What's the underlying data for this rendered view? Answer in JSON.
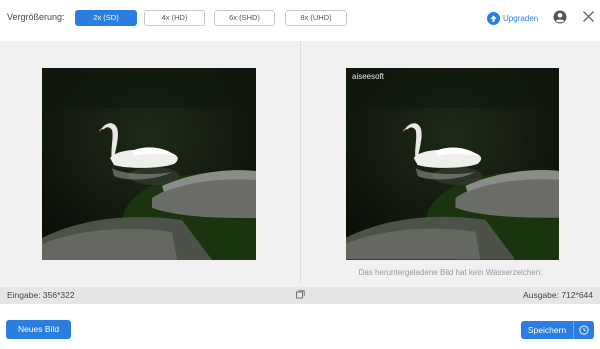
{
  "toolbar": {
    "zoom_label": "Vergrößerung:",
    "scales": [
      {
        "label": "2x (SD)",
        "active": true
      },
      {
        "label": "4x (HD)",
        "active": false
      },
      {
        "label": "6x (SHD)",
        "active": false
      },
      {
        "label": "8x (UHD)",
        "active": false
      }
    ],
    "upgrade_label": "Upgraden",
    "icons": {
      "upgrade": "arrow-up-circle-icon",
      "user": "user-account-icon",
      "close": "close-icon"
    }
  },
  "preview": {
    "watermark": "aiseesoft",
    "no_watermark_note": "Das heruntergeladene Bild hat kein Wasserzeichen."
  },
  "info": {
    "input_size": "Eingabe: 356*322",
    "output_size": "Ausgabe: 712*644",
    "compare_icon": "compare-icon"
  },
  "actions": {
    "new_image": "Neues Bild",
    "save": "Speichern",
    "save_icon": "clock-icon"
  },
  "colors": {
    "accent": "#2a7de1"
  }
}
